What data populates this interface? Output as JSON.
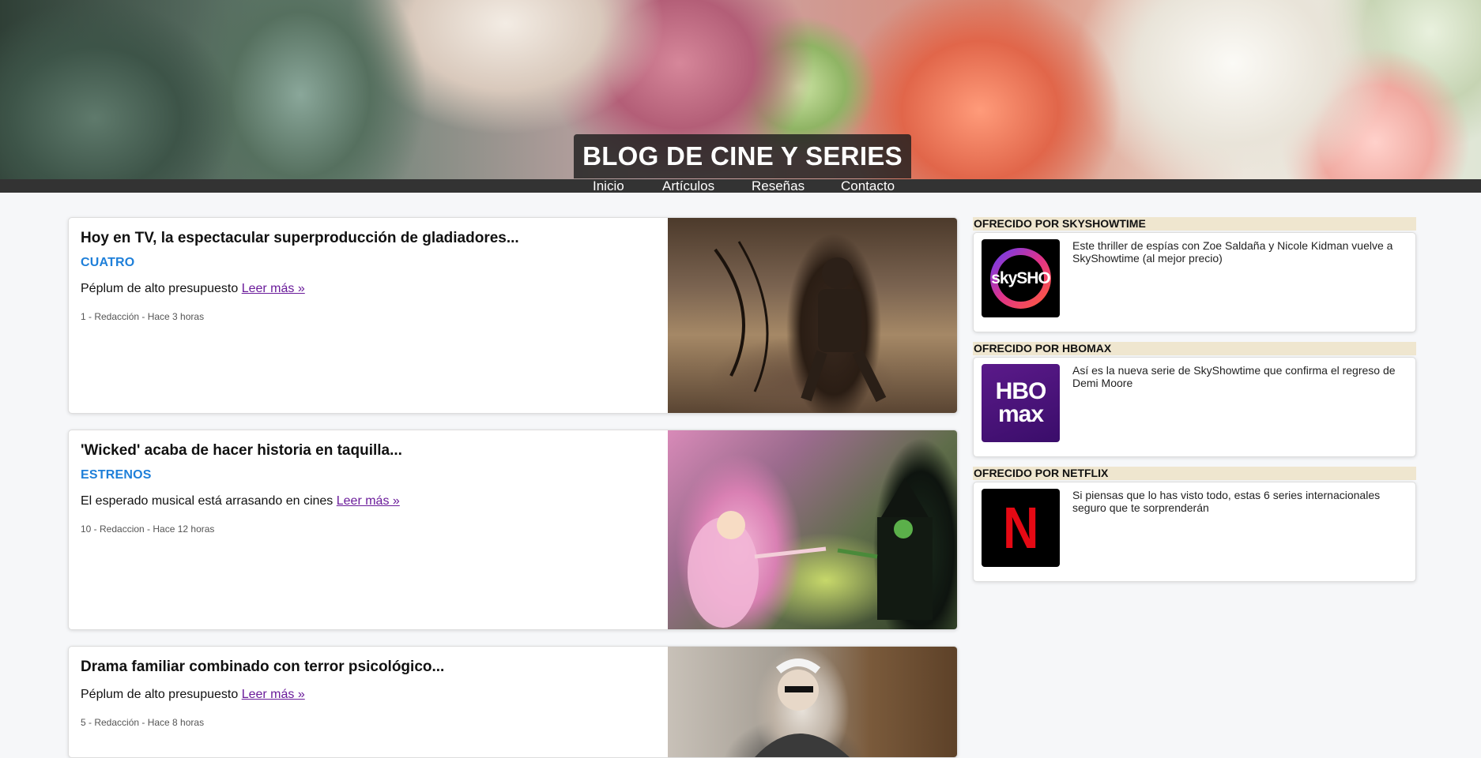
{
  "header": {
    "site_title": "BLOG DE CINE Y SERIES",
    "nav": [
      "Inicio",
      "Artículos",
      "Reseñas",
      "Contacto"
    ]
  },
  "articles": [
    {
      "title": "Hoy en TV, la espectacular superproducción de gladiadores...",
      "category": "CUATRO",
      "excerpt": "Péplum de alto presupuesto",
      "read_more": "Leer más »",
      "meta": "1 - Redacción - Hace 3 horas"
    },
    {
      "title": "'Wicked' acaba de hacer historia en taquilla...",
      "category": "ESTRENOS",
      "excerpt": "El esperado musical está arrasando en cines",
      "read_more": "Leer más »",
      "meta": "10 - Redaccion - Hace 12 horas"
    },
    {
      "title": "Drama familiar combinado con terror psicológico...",
      "excerpt": "Péplum de alto presupuesto",
      "read_more": "Leer más »",
      "meta": "5 - Redacción - Hace 8 horas"
    }
  ],
  "sidebar": {
    "sponsors": [
      {
        "label": "OFRECIDO POR SKYSHOWTIME",
        "logo_text": "skySHO",
        "description": "Este thriller de espías con Zoe Saldaña y Nicole Kidman vuelve a SkyShowtime (al mejor precio)"
      },
      {
        "label": "OFRECIDO POR HBOMAX",
        "logo_text_top": "HBO",
        "logo_text_bottom": "max",
        "description": "Así es la nueva serie de SkyShowtime que confirma el regreso de Demi Moore"
      },
      {
        "label": "OFRECIDO POR NETFLIX",
        "logo_text": "N",
        "description": "Si piensas que lo has visto todo, estas 6 series internacionales seguro que te sorprenderán"
      }
    ]
  },
  "colors": {
    "category": "#1e7fd9",
    "link": "#6a1b9a",
    "navbar": "#333333",
    "sponsor_label_bg": "#efe6cf",
    "netflix_red": "#e50914"
  }
}
